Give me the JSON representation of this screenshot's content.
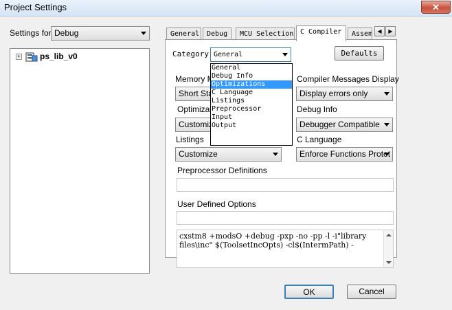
{
  "window": {
    "title": "Project Settings",
    "close_glyph": "✕"
  },
  "settings_for": {
    "label": "Settings for:",
    "value": "Debug"
  },
  "tree": {
    "expander": "+",
    "root_label": "ps_lib_v0",
    "icon": "project-icon"
  },
  "tabs": [
    {
      "label": "General"
    },
    {
      "label": "Debug"
    },
    {
      "label": "MCU Selection"
    },
    {
      "label": "C Compiler",
      "active": true
    },
    {
      "label": "Assem"
    }
  ],
  "tab_scroll": {
    "left": "◀",
    "right": "▶"
  },
  "category": {
    "label": "Category",
    "value": "General",
    "options": [
      "General",
      "Debug Info",
      "Optimizations",
      "C Language",
      "Listings",
      "Preprocessor",
      "Input",
      "Output"
    ],
    "highlighted": "Optimizations"
  },
  "defaults_button": "Defaults",
  "memory_model": {
    "label": "Memory M",
    "value": "Short Stac"
  },
  "compiler_messages": {
    "label": "Compiler Messages Display",
    "value": "Display errors only"
  },
  "optimizations": {
    "label": "Optimizatio",
    "value": "Customize"
  },
  "debug_info": {
    "label": "Debug Info",
    "value": "Debugger Compatible"
  },
  "listings": {
    "label": "Listings",
    "value": "Customize"
  },
  "c_language": {
    "label": "C Language",
    "value": "Enforce Functions Protot"
  },
  "preprocessor": {
    "label": "Preprocessor Definitions",
    "value": ""
  },
  "user_options": {
    "label": "User Defined Options",
    "value": ""
  },
  "command_line": "cxstm8 +modsO +debug -pxp -no -pp -l -i\"library files\\inc\" $(ToolsetIncOpts) -cl$(IntermPath) -",
  "buttons": {
    "ok": "OK",
    "cancel": "Cancel"
  },
  "colors": {
    "selection": "#3399ff",
    "ok_border": "#3c7fb1"
  }
}
